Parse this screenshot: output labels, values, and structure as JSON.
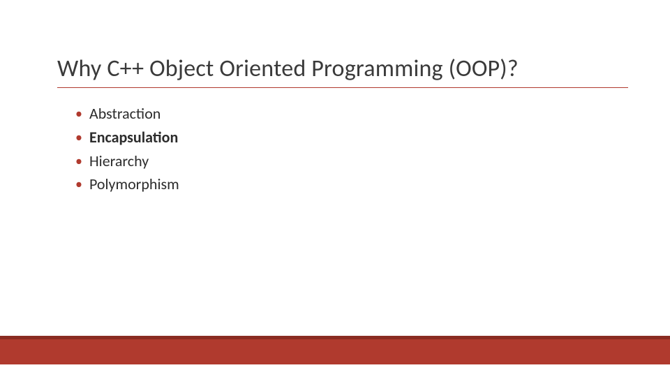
{
  "slide": {
    "title": "Why C++ Object Oriented Programming (OOP)?",
    "bullets": [
      {
        "text": "Abstraction",
        "bold": false
      },
      {
        "text": "Encapsulation",
        "bold": true
      },
      {
        "text": "Hierarchy",
        "bold": false
      },
      {
        "text": "Polymorphism",
        "bold": false
      }
    ],
    "colors": {
      "accent": "#b03a2e",
      "accent_dark": "#8a2c22",
      "text": "#2c2c2c",
      "title_text": "#3a3a3a"
    }
  }
}
